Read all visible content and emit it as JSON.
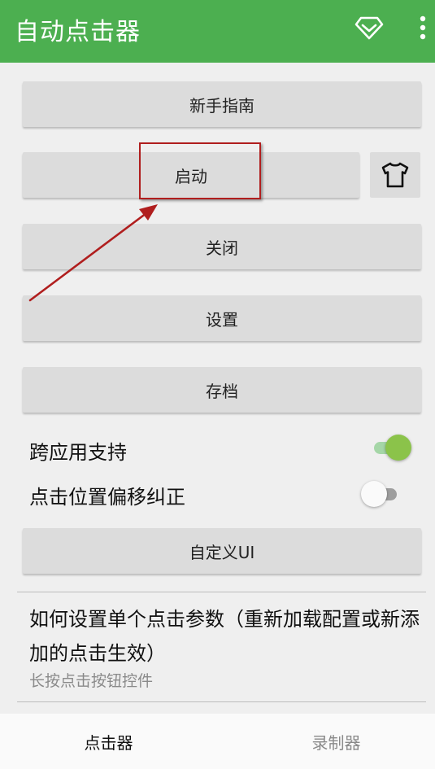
{
  "app_bar": {
    "title": "自动点击器",
    "icons": [
      "gem-icon",
      "more-vert-icon"
    ],
    "color": "#4caf50"
  },
  "buttons": {
    "guide": "新手指南",
    "start": "启动",
    "stop": "关闭",
    "settings": "设置",
    "save": "存档",
    "custom_ui": "自定义UI",
    "skin_icon": "tshirt-icon"
  },
  "toggles": [
    {
      "label": "跨应用支持",
      "on": true
    },
    {
      "label": "点击位置偏移纠正",
      "on": false
    }
  ],
  "help": {
    "title": "如何设置单个点击参数（重新加载配置或新添加的点击生效）",
    "subtitle": "长按点击按钮控件"
  },
  "bottom_nav": {
    "tabs": [
      {
        "label": "点击器",
        "selected": true
      },
      {
        "label": "录制器",
        "selected": false
      }
    ]
  },
  "annotation": {
    "color": "#b01e1e"
  }
}
